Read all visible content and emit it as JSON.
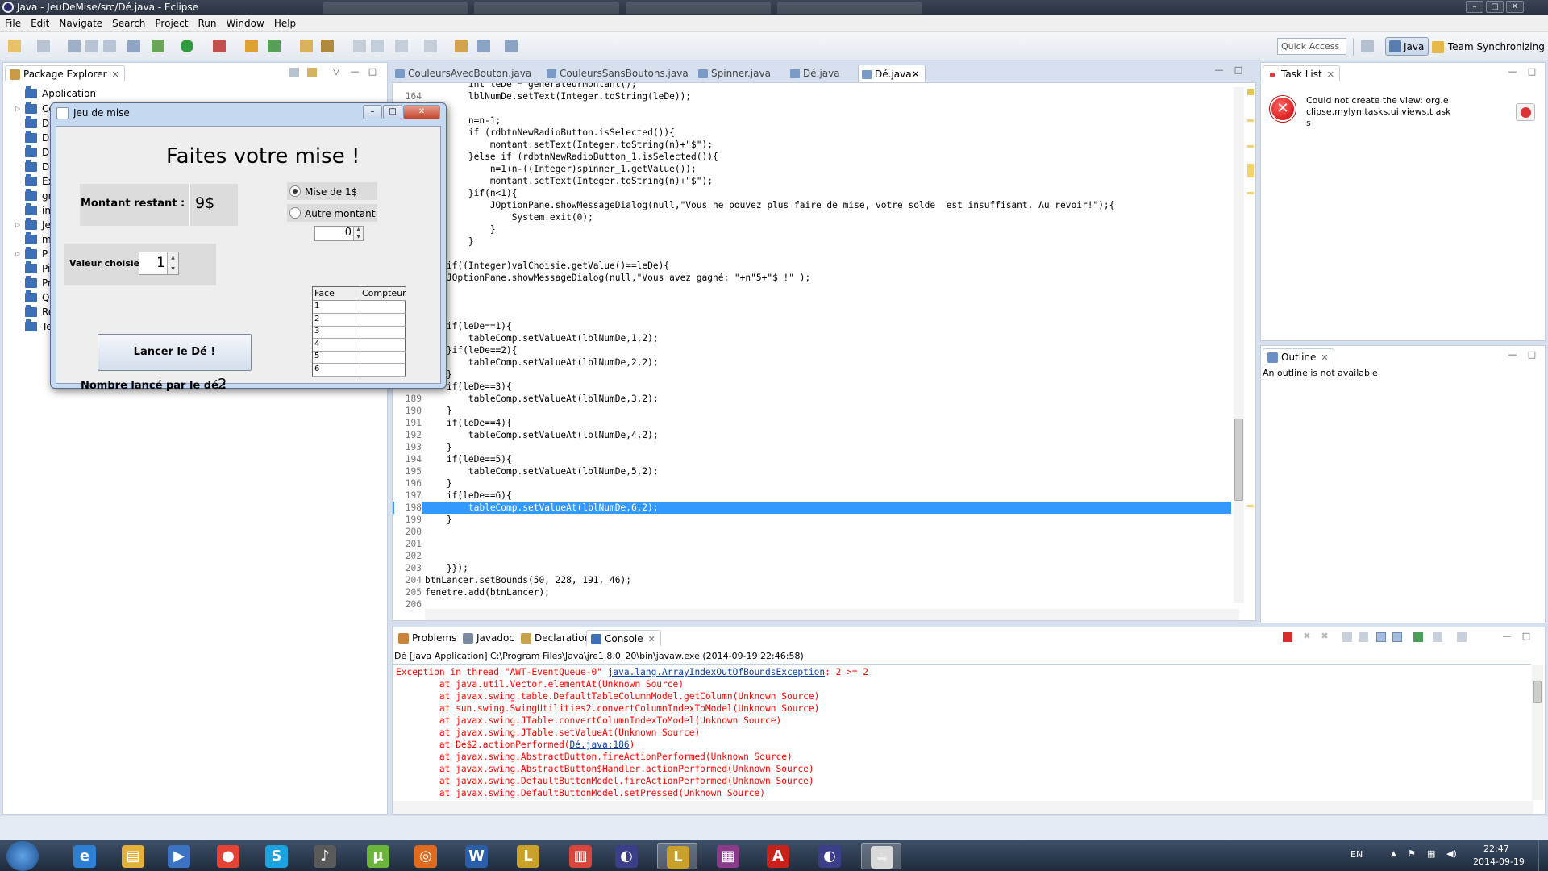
{
  "window": {
    "title": "Java - JeuDeMise/src/Dé.java - Eclipse",
    "controls": [
      "minimize",
      "maximize",
      "close"
    ]
  },
  "menu": [
    "File",
    "Edit",
    "Navigate",
    "Search",
    "Project",
    "Run",
    "Window",
    "Help"
  ],
  "toolbar": {
    "quick_access_placeholder": "Quick Access",
    "perspectives": [
      "Java",
      "Team Synchronizing"
    ]
  },
  "package_explorer": {
    "title": "Package Explorer",
    "items": [
      "Application",
      "Co",
      "DC",
      "DE",
      "DF",
      "DS",
      "Ex",
      "gr",
      "int",
      "Jeu",
      "m",
      "P",
      "Pil",
      "Pr",
      "Qu",
      "Re",
      "Te"
    ]
  },
  "editor": {
    "tabs": [
      "CouleursAvecBouton.java",
      "CouleursSansBoutons.java",
      "Spinner.java",
      "Dé.java",
      "Dé.java"
    ],
    "active_tab_index": 4,
    "lines": [
      {
        "n": "",
        "t": "        int leDe = generateurMontant();"
      },
      {
        "n": "164",
        "t": "        lblNumDe.setText(Integer.toString(leDe));"
      },
      {
        "n": "",
        "t": ""
      },
      {
        "n": "",
        "t": "        n=n-1;"
      },
      {
        "n": "",
        "t": "        if (rdbtnNewRadioButton.isSelected()){"
      },
      {
        "n": "",
        "t": "            montant.setText(Integer.toString(n)+\"$\");"
      },
      {
        "n": "",
        "t": "        }else if (rdbtnNewRadioButton_1.isSelected()){"
      },
      {
        "n": "",
        "t": "            n=1+n-((Integer)spinner_1.getValue());"
      },
      {
        "n": "",
        "t": "            montant.setText(Integer.toString(n)+\"$\");"
      },
      {
        "n": "",
        "t": "        }if(n<1){"
      },
      {
        "n": "",
        "t": "            JOptionPane.showMessageDialog(null,\"Vous ne pouvez plus faire de mise, votre solde  est insuffisant. Au revoir!\");{"
      },
      {
        "n": "",
        "t": "                System.exit(0);"
      },
      {
        "n": "",
        "t": "            }"
      },
      {
        "n": "",
        "t": "        }"
      },
      {
        "n": "",
        "t": ""
      },
      {
        "n": "",
        "t": "    if((Integer)valChoisie.getValue()==leDe){"
      },
      {
        "n": "",
        "t": "    JOptionPane.showMessageDialog(null,\"Vous avez gagné: \"+n\"5+\"$ !\" );"
      },
      {
        "n": "",
        "t": "}"
      },
      {
        "n": "",
        "t": ""
      },
      {
        "n": "",
        "t": ""
      },
      {
        "n": "",
        "t": "    if(leDe==1){"
      },
      {
        "n": "",
        "t": "        tableComp.setValueAt(lblNumDe,1,2);"
      },
      {
        "n": "",
        "t": "    }if(leDe==2){"
      },
      {
        "n": "",
        "t": "        tableComp.setValueAt(lblNumDe,2,2);"
      },
      {
        "n": "",
        "t": "    }"
      },
      {
        "n": "",
        "t": "    if(leDe==3){"
      },
      {
        "n": "189",
        "t": "        tableComp.setValueAt(lblNumDe,3,2);"
      },
      {
        "n": "190",
        "t": "    }"
      },
      {
        "n": "191",
        "t": "    if(leDe==4){"
      },
      {
        "n": "192",
        "t": "        tableComp.setValueAt(lblNumDe,4,2);"
      },
      {
        "n": "193",
        "t": "    }"
      },
      {
        "n": "194",
        "t": "    if(leDe==5){"
      },
      {
        "n": "195",
        "t": "        tableComp.setValueAt(lblNumDe,5,2);"
      },
      {
        "n": "196",
        "t": "    }"
      },
      {
        "n": "197",
        "t": "    if(leDe==6){"
      },
      {
        "n": "198",
        "t": "        tableComp.setValueAt(lblNumDe,6,2);"
      },
      {
        "n": "199",
        "t": "    }"
      },
      {
        "n": "200",
        "t": ""
      },
      {
        "n": "201",
        "t": ""
      },
      {
        "n": "202",
        "t": ""
      },
      {
        "n": "203",
        "t": "    }});"
      },
      {
        "n": "204",
        "t": "btnLancer.setBounds(50, 228, 191, 46);"
      },
      {
        "n": "205",
        "t": "fenetre.add(btnLancer);"
      },
      {
        "n": "206",
        "t": ""
      }
    ],
    "highlighted_line": "198"
  },
  "task_list": {
    "title": "Task List",
    "error_message": "Could not create the view: org.eclipse.mylyn.tasks.ui.views.t asks"
  },
  "outline": {
    "title": "Outline",
    "message": "An outline is not available."
  },
  "bottom_tabs": [
    "Problems",
    "Javadoc",
    "Declaration",
    "Console"
  ],
  "console": {
    "header": "Dé [Java Application] C:\\Program Files\\Java\\jre1.8.0_20\\bin\\javaw.exe (2014-09-19 22:46:58)",
    "first_prefix": "Exception in thread \"AWT-EventQueue-0\" ",
    "first_link": "java.lang.ArrayIndexOutOfBoundsException",
    "first_suffix": ": 2 >= 2",
    "lines": [
      "        at java.util.Vector.elementAt(Unknown Source)",
      "        at javax.swing.table.DefaultTableColumnModel.getColumn(Unknown Source)",
      "        at sun.swing.SwingUtilities2.convertColumnIndexToModel(Unknown Source)",
      "        at javax.swing.JTable.convertColumnIndexToModel(Unknown Source)",
      "        at javax.swing.JTable.setValueAt(Unknown Source)"
    ],
    "link_line_prefix": "        at Dé$2.actionPerformed(",
    "link_line_link": "Dé.java:186",
    "link_line_suffix": ")",
    "lines_after": [
      "        at javax.swing.AbstractButton.fireActionPerformed(Unknown Source)",
      "        at javax.swing.AbstractButton$Handler.actionPerformed(Unknown Source)",
      "        at javax.swing.DefaultButtonModel.fireActionPerformed(Unknown Source)",
      "        at javax.swing.DefaultButtonModel.setPressed(Unknown Source)"
    ]
  },
  "dialog": {
    "title": "Jeu de mise",
    "heading": "Faites votre mise !",
    "montant_label": "Montant restant :",
    "montant_value": "9$",
    "radio_1": "Mise de 1$",
    "radio_2": "Autre montant",
    "radio_selected": "Mise de 1$",
    "autre_value": "0",
    "valeur_label": "Valeur choisie :",
    "valeur_value": "1",
    "button": "Lancer le Dé !",
    "nombre_label": "Nombre lancé par le dé :",
    "nombre_value": "2",
    "table_headers": [
      "Face",
      "Compteur"
    ],
    "table_rows": [
      "1",
      "2",
      "3",
      "4",
      "5",
      "6"
    ]
  },
  "taskbar": {
    "language": "EN",
    "time": "22:47",
    "date": "2014-09-19",
    "apps": [
      "internet-explorer",
      "file-explorer",
      "media-player",
      "chrome",
      "skype",
      "eclipse-alt",
      "utorrent",
      "headphones",
      "word",
      "league",
      "popcorn",
      "eclipse",
      "league-2",
      "winrar",
      "acrobat",
      "eclipse-2",
      "java"
    ]
  }
}
